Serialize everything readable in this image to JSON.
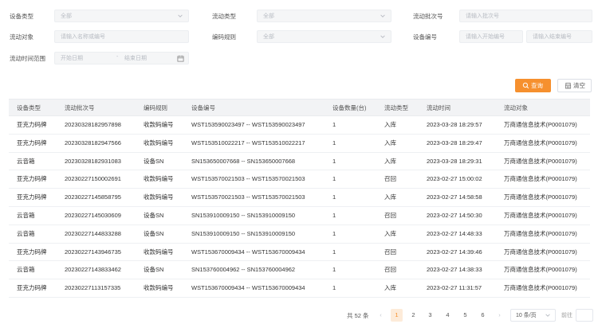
{
  "filters": {
    "device_type": {
      "label": "设备类型",
      "value": "全部"
    },
    "flow_type": {
      "label": "流动类型",
      "value": "全部"
    },
    "batch_no": {
      "label": "流动批次号",
      "placeholder": "请输入批次号"
    },
    "flow_object": {
      "label": "流动对象",
      "placeholder": "请输入名称或编号"
    },
    "code_rule": {
      "label": "编码规则",
      "value": "全部"
    },
    "device_no": {
      "label": "设备编号",
      "start_placeholder": "请输入开始编号",
      "end_placeholder": "请输入结束编号"
    },
    "time_range": {
      "label": "流动时间范围",
      "start_placeholder": "开始日期",
      "separator": "-",
      "end_placeholder": "结束日期"
    }
  },
  "actions": {
    "query_label": "查询",
    "clear_label": "清空"
  },
  "table": {
    "headers": [
      "设备类型",
      "流动批次号",
      "编码规则",
      "设备编号",
      "设备数量(台)",
      "流动类型",
      "流动时间",
      "流动对象"
    ],
    "rows": [
      [
        "亚克力码牌",
        "20230328182957898",
        "收款码编号",
        "WST153590023497 -- WST153590023497",
        "1",
        "入库",
        "2023-03-28 18:29:57",
        "万商通信息技术(P0001079)"
      ],
      [
        "亚克力码牌",
        "20230328182947566",
        "收款码编号",
        "WST153510022217 -- WST153510022217",
        "1",
        "入库",
        "2023-03-28 18:29:47",
        "万商通信息技术(P0001079)"
      ],
      [
        "云音箱",
        "20230328182931083",
        "设备SN",
        "SN153650007668 -- SN153650007668",
        "1",
        "入库",
        "2023-03-28 18:29:31",
        "万商通信息技术(P0001079)"
      ],
      [
        "亚克力码牌",
        "20230227150002691",
        "收款码编号",
        "WST153570021503 -- WST153570021503",
        "1",
        "召回",
        "2023-02-27 15:00:02",
        "万商通信息技术(P0001079)"
      ],
      [
        "亚克力码牌",
        "20230227145858795",
        "收款码编号",
        "WST153570021503 -- WST153570021503",
        "1",
        "入库",
        "2023-02-27 14:58:58",
        "万商通信息技术(P0001079)"
      ],
      [
        "云音箱",
        "20230227145030609",
        "设备SN",
        "SN153910009150 -- SN153910009150",
        "1",
        "召回",
        "2023-02-27 14:50:30",
        "万商通信息技术(P0001079)"
      ],
      [
        "云音箱",
        "20230227144833288",
        "设备SN",
        "SN153910009150 -- SN153910009150",
        "1",
        "入库",
        "2023-02-27 14:48:33",
        "万商通信息技术(P0001079)"
      ],
      [
        "亚克力码牌",
        "20230227143946735",
        "收款码编号",
        "WST153670009434 -- WST153670009434",
        "1",
        "召回",
        "2023-02-27 14:39:46",
        "万商通信息技术(P0001079)"
      ],
      [
        "云音箱",
        "20230227143833462",
        "设备SN",
        "SN153760004962 -- SN153760004962",
        "1",
        "召回",
        "2023-02-27 14:38:33",
        "万商通信息技术(P0001079)"
      ],
      [
        "亚克力码牌",
        "20230227113157335",
        "收款码编号",
        "WST153670009434 -- WST153670009434",
        "1",
        "入库",
        "2023-02-27 11:31:57",
        "万商通信息技术(P0001079)"
      ]
    ]
  },
  "pagination": {
    "total_text": "共 52 条",
    "prev": "‹",
    "pages": [
      "1",
      "2",
      "3",
      "4",
      "5",
      "6"
    ],
    "active_page": "1",
    "next": "›",
    "page_size": "10 条/页",
    "jump_label": "前往"
  },
  "colors": {
    "accent": "#f6902e",
    "header_bg": "#f2f3f5",
    "field_bg": "#f5f6f7"
  },
  "icons": {
    "query": "search-icon",
    "clear": "clear-icon",
    "select": "chevron-down-icon",
    "date": "calendar-icon"
  }
}
